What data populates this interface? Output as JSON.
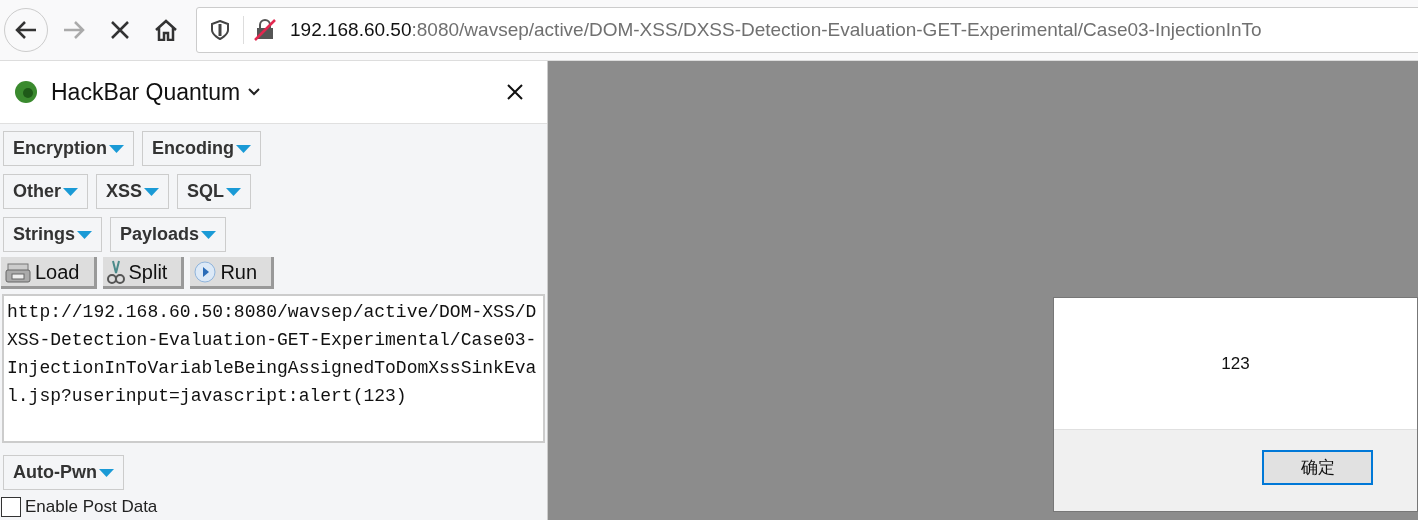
{
  "toolbar": {
    "url_host": "192.168.60.50",
    "url_rest": ":8080/wavsep/active/DOM-XSS/DXSS-Detection-Evaluation-GET-Experimental/Case03-InjectionInTo"
  },
  "sidebar": {
    "title": "HackBar Quantum",
    "menu_rows": [
      [
        "Encryption",
        "Encoding"
      ],
      [
        "Other",
        "XSS",
        "SQL"
      ],
      [
        "Strings",
        "Payloads"
      ]
    ],
    "actions": [
      {
        "label": "Load",
        "kind": "load"
      },
      {
        "label": "Split",
        "kind": "split"
      },
      {
        "label": "Run",
        "kind": "run"
      }
    ],
    "url_value": "http://192.168.60.50:8080/wavsep/active/DOM-XSS/DXSS-Detection-Evaluation-GET-Experimental/Case03-InjectionInToVariableBeingAssignedToDomXssSinkEval.jsp?userinput=javascript:alert(123)",
    "auto_pwn": "Auto-Pwn",
    "post_data": {
      "label": "Enable Post Data",
      "checked": false
    }
  },
  "alert": {
    "message": "123",
    "button": "确定"
  }
}
